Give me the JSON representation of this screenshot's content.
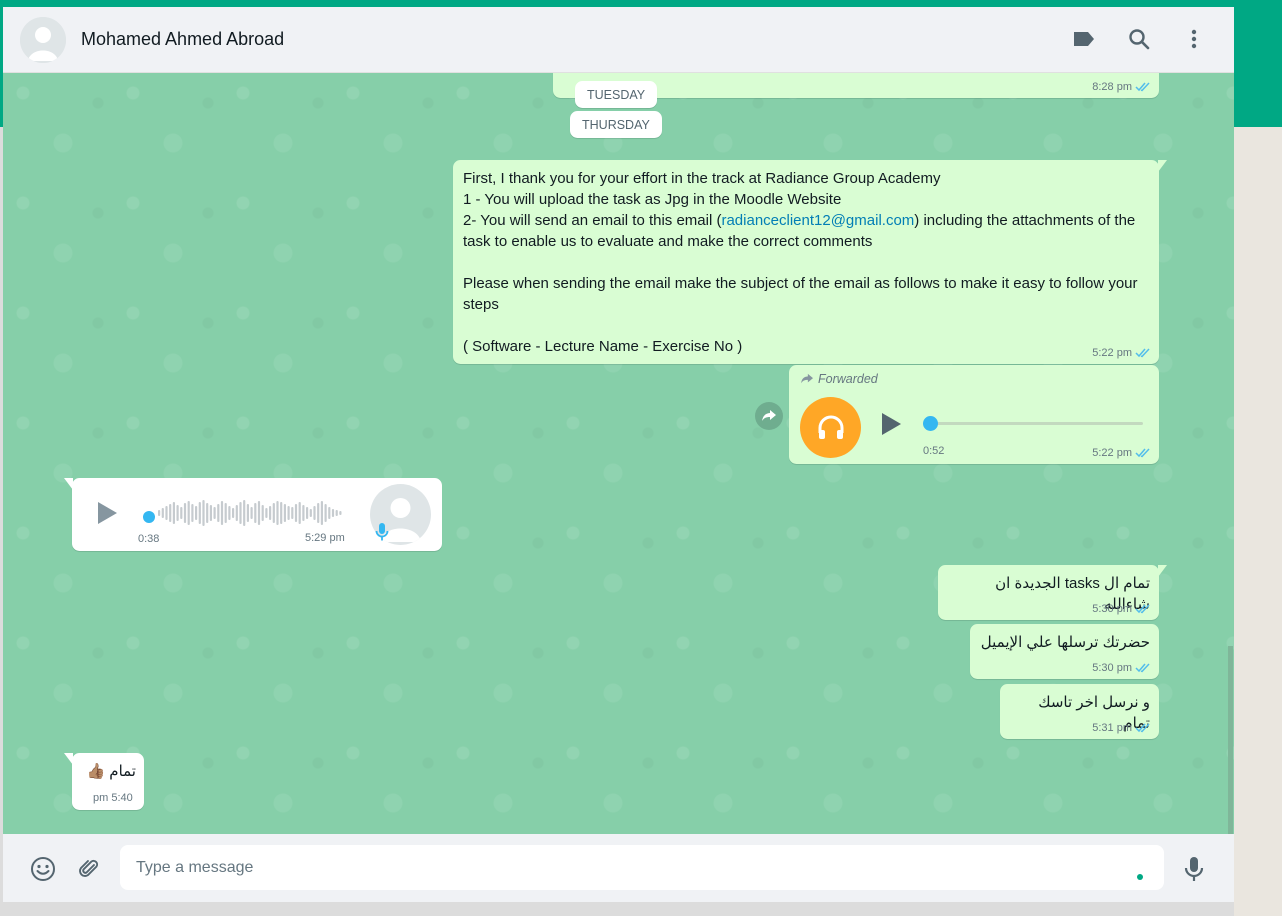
{
  "contact": {
    "name": "Mohamed Ahmed Abroad"
  },
  "colors": {
    "accent": "#00a884",
    "outgoing": "#d9fdd3",
    "incoming": "#ffffff",
    "tick_read": "#53bdeb",
    "audio_orange": "#ffa726"
  },
  "header": {
    "icons": [
      "label-icon",
      "search-icon",
      "menu-icon"
    ]
  },
  "prev_message": {
    "time": "8:28 pm"
  },
  "day_labels": [
    "TUESDAY",
    "THURSDAY"
  ],
  "messages": {
    "instructions": {
      "text_before_link": "First, I thank you for your effort in the track at Radiance Group Academy\n1 - You will upload the task as Jpg in the Moodle Website\n2- You will send an email to this email (",
      "link": "radianceclient12@gmail.com",
      "text_after_link": ") including the attachments of the task to enable us to evaluate and make the correct comments\n\nPlease when sending the email make the subject of the email as follows to make it easy to follow your steps\n\n( Software - Lecture Name - Exercise No )",
      "time": "5:22 pm"
    },
    "forwarded_audio": {
      "label": "Forwarded",
      "duration": "0:52",
      "time": "5:22 pm",
      "progress": 0
    },
    "incoming_voice": {
      "duration": "0:38",
      "time": "5:29 pm",
      "progress": 0
    },
    "tasks_msg": {
      "text": "تمام ال tasks الجديدة ان شاءالله",
      "time": "5:30 pm"
    },
    "email_msg": {
      "text": "حضرتك ترسلها علي الإيميل",
      "time": "5:30 pm"
    },
    "last_task_msg": {
      "text": "و نرسل اخر تاسك تمام",
      "time": "5:31 pm"
    },
    "ok_msg": {
      "text": "تمام 👍🏽",
      "time": "5:40 pm"
    }
  },
  "footer": {
    "placeholder": "Type a message"
  }
}
